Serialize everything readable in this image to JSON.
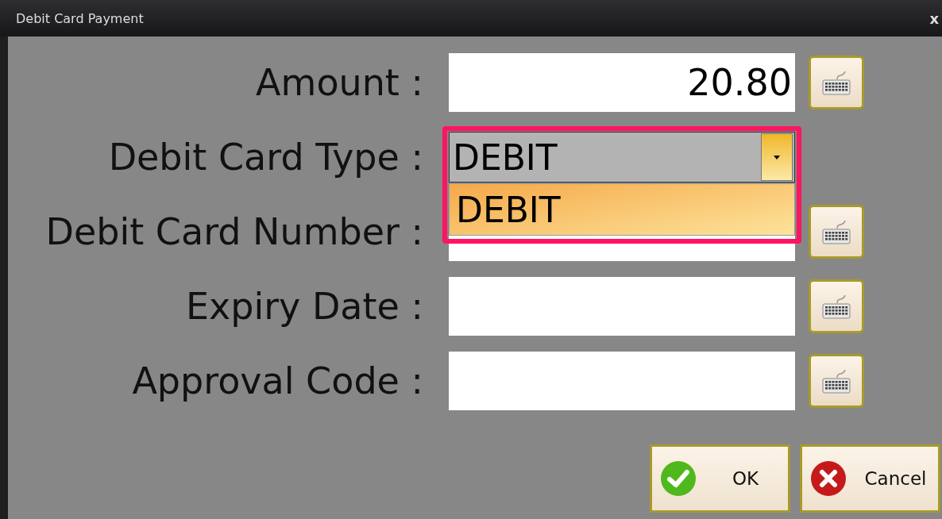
{
  "window": {
    "title": "Debit Card Payment",
    "close": "x"
  },
  "fields": [
    {
      "kind": "text",
      "label": "Amount :",
      "value": "20.80"
    },
    {
      "kind": "dropdown",
      "label": "Debit Card Type :",
      "value": "DEBIT",
      "expanded": true,
      "options": [
        {
          "label": "DEBIT",
          "selected": true
        }
      ]
    },
    {
      "kind": "text",
      "label": "Debit Card Number :"
    },
    {
      "kind": "text",
      "label": "Expiry Date :"
    },
    {
      "kind": "text",
      "label": "Approval Code :"
    }
  ],
  "buttons": [
    {
      "kind": "ok",
      "label": "OK"
    },
    {
      "kind": "cancel",
      "label": "Cancel"
    }
  ]
}
